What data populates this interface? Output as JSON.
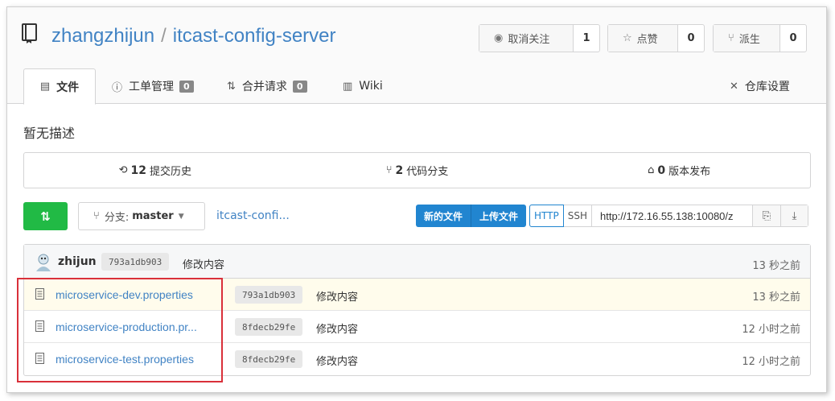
{
  "repo": {
    "owner": "zhangzhijun",
    "separator": "/",
    "name": "itcast-config-server"
  },
  "actions": {
    "watch": {
      "label": "取消关注",
      "count": "1"
    },
    "star": {
      "label": "点赞",
      "count": "0"
    },
    "fork": {
      "label": "派生",
      "count": "0"
    }
  },
  "tabs": [
    {
      "label": "文件"
    },
    {
      "label": "工单管理",
      "badge": "0"
    },
    {
      "label": "合并请求",
      "badge": "0"
    },
    {
      "label": "Wiki"
    },
    {
      "label": "仓库设置"
    }
  ],
  "description": "暂无描述",
  "stats": {
    "commits": {
      "count": "12",
      "label": "提交历史"
    },
    "branches": {
      "count": "2",
      "label": "代码分支"
    },
    "releases": {
      "count": "0",
      "label": "版本发布"
    }
  },
  "toolbar": {
    "branch_prefix": "分支:",
    "branch_name": "master",
    "breadcrumb": "itcast-confi...",
    "new_file": "新的文件",
    "upload_file": "上传文件",
    "http": "HTTP",
    "ssh": "SSH",
    "clone_url": "http://172.16.55.138:10080/z"
  },
  "latest_commit": {
    "author": "zhijun",
    "sha": "793a1db903",
    "message": "修改内容",
    "age": "13 秒之前"
  },
  "files": [
    {
      "name": "microservice-dev.properties",
      "sha": "793a1db903",
      "message": "修改内容",
      "age": "13 秒之前"
    },
    {
      "name": "microservice-production.pr...",
      "sha": "8fdecb29fe",
      "message": "修改内容",
      "age": "12 小时之前"
    },
    {
      "name": "microservice-test.properties",
      "sha": "8fdecb29fe",
      "message": "修改内容",
      "age": "12 小时之前"
    }
  ],
  "colors": {
    "link": "#4183c4",
    "green": "#21ba45",
    "blue": "#2185d0",
    "highlight_row": "#fffcec",
    "annotation_red": "#d9303a"
  }
}
